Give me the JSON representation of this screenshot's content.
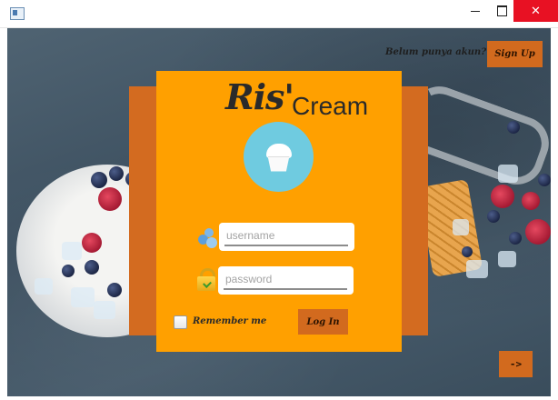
{
  "window": {
    "minimize_glyph": "",
    "close_glyph": "✕"
  },
  "signup": {
    "prompt": "Belum punya akun?",
    "button_label": "Sign Up"
  },
  "brand": {
    "part1": "Ris'",
    "part2": "Cream"
  },
  "login": {
    "username_placeholder": "username",
    "username_value": "",
    "password_placeholder": "password",
    "password_value": "",
    "remember_label": "Remember me",
    "remember_checked": false,
    "login_button_label": "Log In"
  },
  "nav": {
    "next_label": "->"
  },
  "colors": {
    "card": "#ffa000",
    "card_back": "#d36b20",
    "button": "#d26a1e",
    "logo_circle": "#6fcbe0",
    "close_button": "#e81123"
  },
  "icons": {
    "app": "window-app-icon",
    "logo": "ice-cream-cup-icon",
    "username": "users-icon",
    "password": "lock-icon"
  }
}
